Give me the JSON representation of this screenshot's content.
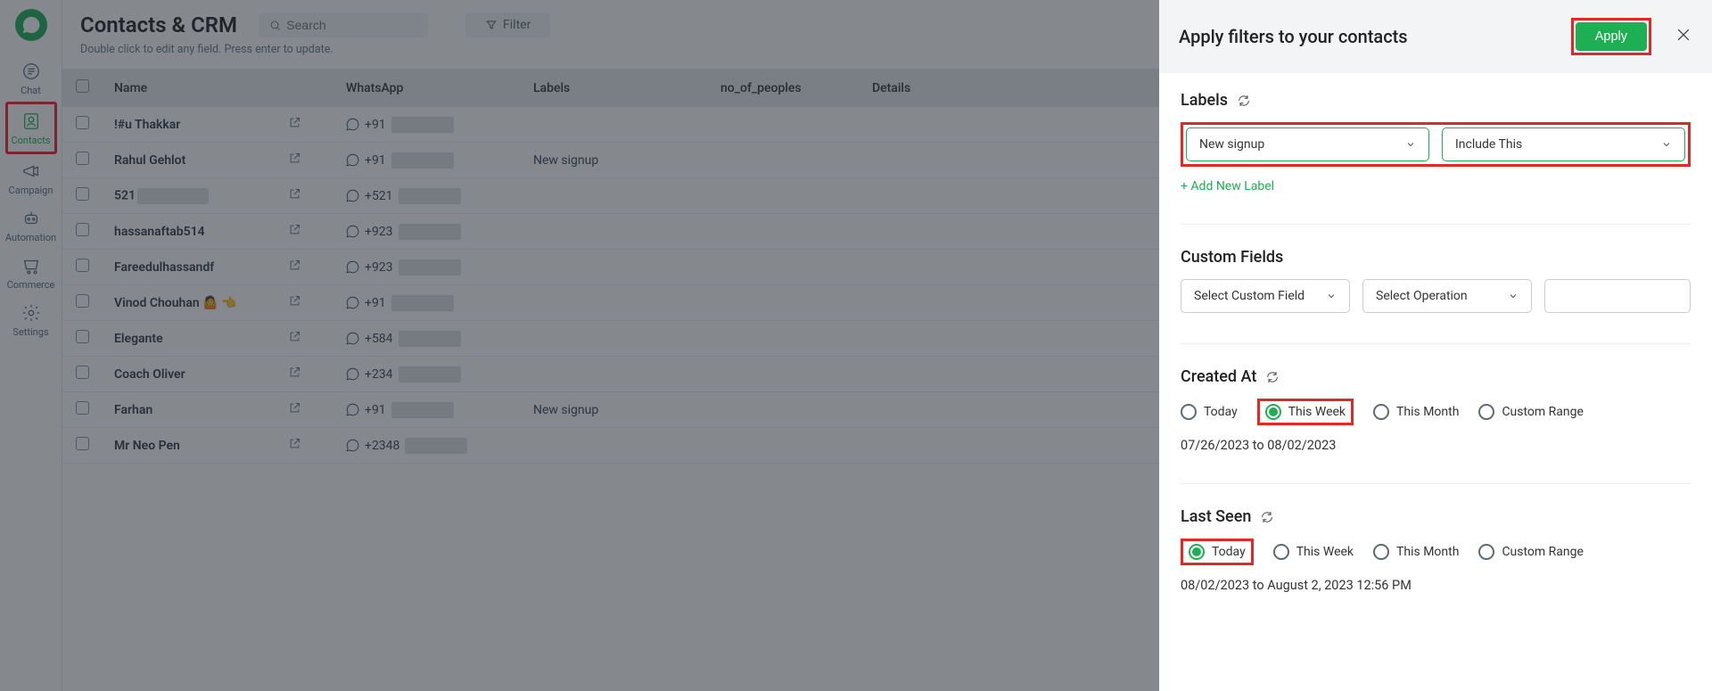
{
  "nav": {
    "items": [
      {
        "label": "Chat"
      },
      {
        "label": "Contacts"
      },
      {
        "label": "Campaign"
      },
      {
        "label": "Automation"
      },
      {
        "label": "Commerce"
      },
      {
        "label": "Settings"
      }
    ]
  },
  "header": {
    "title": "Contacts & CRM",
    "search_placeholder": "Search",
    "filter_label": "Filter",
    "hint": "Double click to edit any field. Press enter to update."
  },
  "table": {
    "columns": {
      "name": "Name",
      "whatsapp": "WhatsApp",
      "labels": "Labels",
      "nop": "no_of_peoples",
      "details": "Details"
    },
    "rows": [
      {
        "name": "!#u Thakkar",
        "wa_prefix": "+91",
        "label": ""
      },
      {
        "name": "Rahul Gehlot",
        "wa_prefix": "+91",
        "label": "New signup"
      },
      {
        "name": "521",
        "wa_prefix": "+521",
        "label": "",
        "name_masked": true
      },
      {
        "name": "hassanaftab514",
        "wa_prefix": "+923",
        "label": ""
      },
      {
        "name": "Fareedulhassandf",
        "wa_prefix": "+923",
        "label": ""
      },
      {
        "name": "Vinod Chouhan 🤷 👈",
        "wa_prefix": "+91",
        "label": ""
      },
      {
        "name": "Elegante",
        "wa_prefix": "+584",
        "label": ""
      },
      {
        "name": "Coach Oliver",
        "wa_prefix": "+234",
        "label": ""
      },
      {
        "name": "Farhan",
        "wa_prefix": "+91",
        "label": "New signup"
      },
      {
        "name": "Mr Neo Pen",
        "wa_prefix": "+2348",
        "label": ""
      }
    ]
  },
  "panel": {
    "title": "Apply filters to your contacts",
    "apply_label": "Apply",
    "labels": {
      "heading": "Labels",
      "value": "New signup",
      "op": "Include This",
      "add": "+ Add New Label"
    },
    "custom_fields": {
      "heading": "Custom Fields",
      "field_placeholder": "Select Custom Field",
      "op_placeholder": "Select Operation"
    },
    "created_at": {
      "heading": "Created At",
      "options": {
        "today": "Today",
        "week": "This Week",
        "month": "This Month",
        "custom": "Custom Range"
      },
      "range": "07/26/2023 to 08/02/2023"
    },
    "last_seen": {
      "heading": "Last Seen",
      "options": {
        "today": "Today",
        "week": "This Week",
        "month": "This Month",
        "custom": "Custom Range"
      },
      "range": "08/02/2023 to August 2, 2023 12:56 PM"
    }
  }
}
